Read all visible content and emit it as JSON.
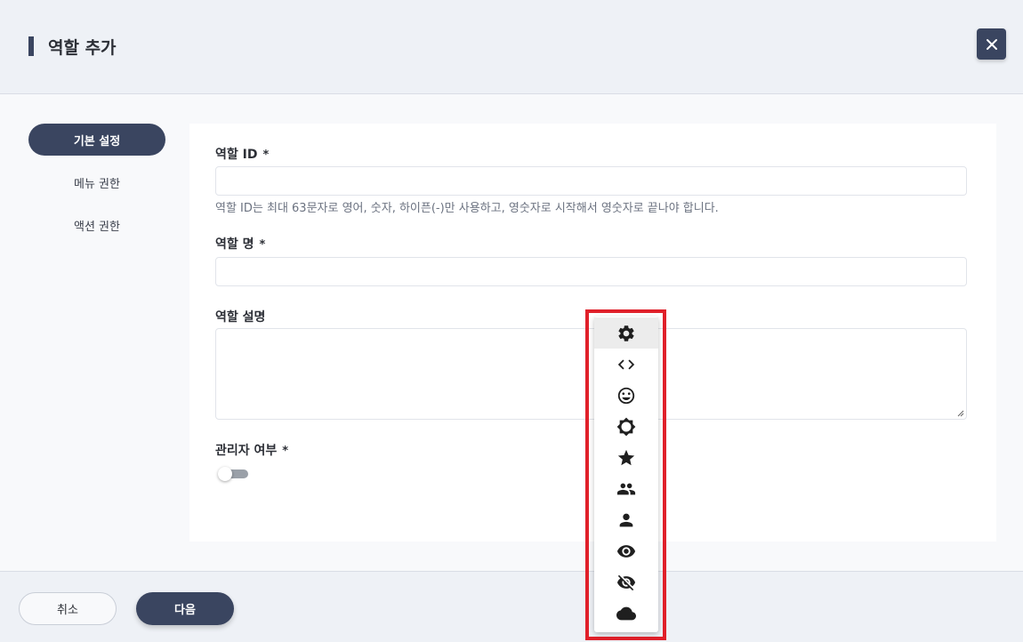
{
  "header": {
    "title": "역할 추가"
  },
  "sidebar": {
    "items": [
      {
        "label": "기본 설정",
        "active": true
      },
      {
        "label": "메뉴 권한",
        "active": false
      },
      {
        "label": "액션 권한",
        "active": false
      }
    ]
  },
  "form": {
    "role_id": {
      "label": "역할 ID",
      "required_mark": "*",
      "value": "",
      "hint": "역할 ID는 최대 63문자로 영어, 숫자, 하이픈(-)만 사용하고, 영숫자로 시작해서 영숫자로 끝나야 합니다."
    },
    "role_name": {
      "label": "역할 명",
      "required_mark": "*",
      "value": ""
    },
    "role_desc": {
      "label": "역할 설명",
      "value": ""
    },
    "is_admin": {
      "label": "관리자 여부",
      "required_mark": "*",
      "checked": false
    }
  },
  "footer": {
    "cancel_label": "취소",
    "next_label": "다음"
  },
  "icon_picker": {
    "icons": [
      "settings-icon",
      "code-icon",
      "smiley-icon",
      "brightness-icon",
      "star-icon",
      "group-icon",
      "person-icon",
      "eye-icon",
      "eye-off-icon",
      "cloud-icon"
    ],
    "selected_index": 0
  },
  "colors": {
    "primary": "#3a4560",
    "highlight": "#e0202a"
  }
}
